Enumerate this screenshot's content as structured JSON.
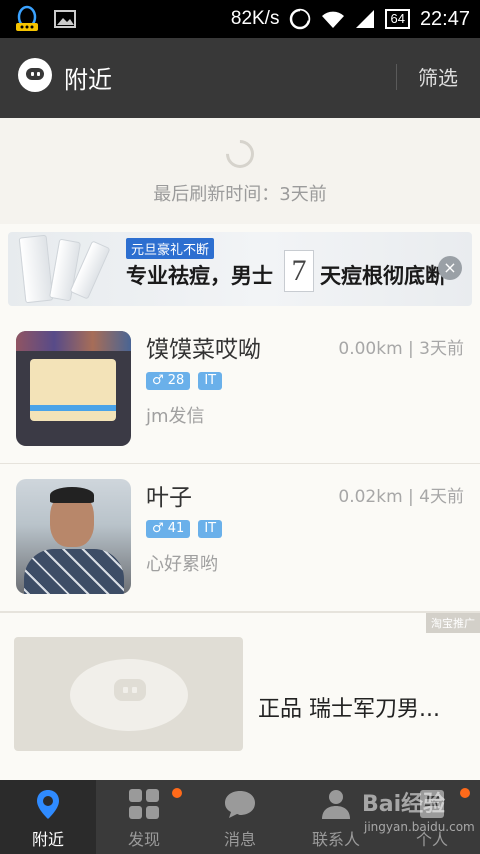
{
  "status_bar": {
    "speed": "82K/s",
    "battery": "64",
    "time": "22:47"
  },
  "app_bar": {
    "title": "附近",
    "filter_label": "筛选"
  },
  "refresh": {
    "text": "最后刷新时间：3天前"
  },
  "banner": {
    "tag": "元旦豪礼不断",
    "line_left": "专业祛痘，男士",
    "digit": "7",
    "line_right": "天痘根彻底断",
    "close": "×"
  },
  "people": [
    {
      "name": "馍馍菜哎呦",
      "distance": "0.00km | 3天前",
      "age": "♂ 28",
      "job": "IT",
      "signature": "jm发信"
    },
    {
      "name": "叶子",
      "distance": "0.02km | 4天前",
      "age": "♂ 41",
      "job": "IT",
      "signature": "心好累哟"
    }
  ],
  "taobao": {
    "tag": "淘宝推广",
    "title": "正品 瑞士军刀男..."
  },
  "nav": {
    "items": [
      {
        "label": "附近",
        "icon": "location-pin-icon"
      },
      {
        "label": "发现",
        "icon": "grid-icon"
      },
      {
        "label": "消息",
        "icon": "chat-bubble-icon"
      },
      {
        "label": "联系人",
        "icon": "contact-icon"
      },
      {
        "label": "个人",
        "icon": "profile-card-icon"
      }
    ],
    "watermark": "Bai经验",
    "watermark_sub": "jingyan.baidu.com"
  },
  "colors": {
    "accent": "#3a8ee6",
    "badge": "#6ab0ea",
    "notification_dot": "#ff6a1a",
    "bar": "#383838"
  }
}
